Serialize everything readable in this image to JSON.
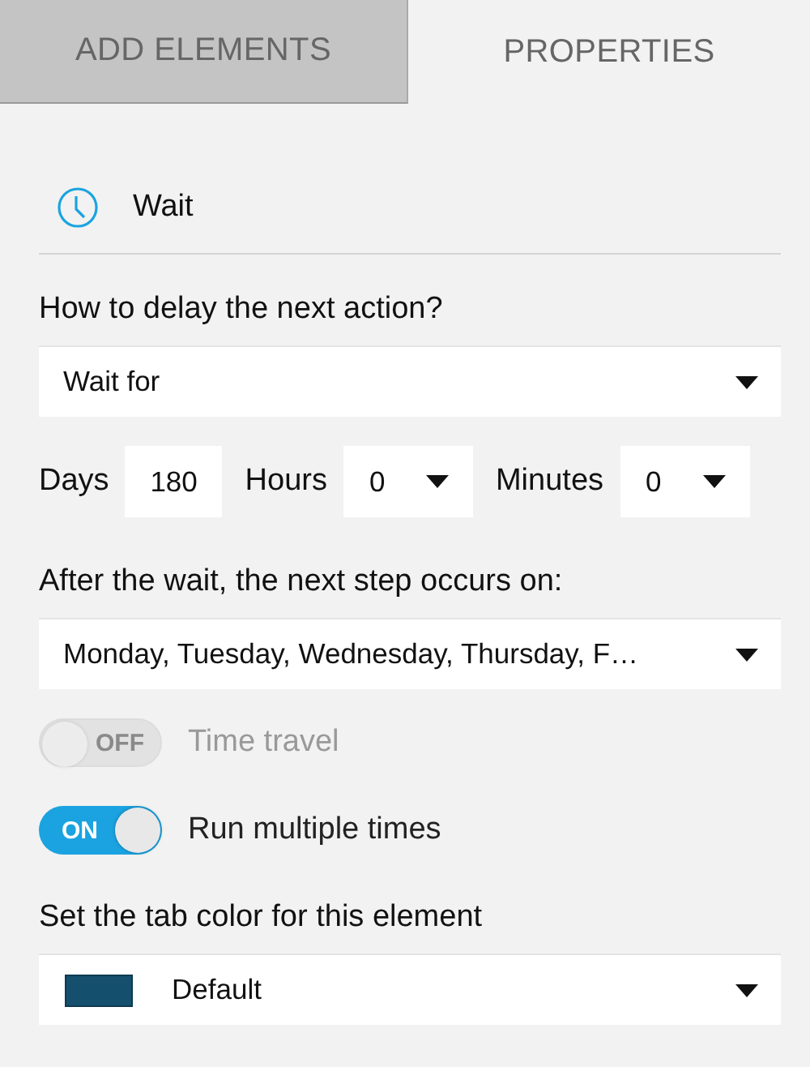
{
  "tabs": [
    {
      "label": "ADD ELEMENTS",
      "selected": false
    },
    {
      "label": "PROPERTIES",
      "selected": true
    }
  ],
  "element": {
    "title": "Wait"
  },
  "delay": {
    "label": "How to delay the next action?",
    "value": "Wait for"
  },
  "duration": [
    {
      "label": "Days",
      "kind": "input",
      "value": "180"
    },
    {
      "label": "Hours",
      "kind": "select",
      "value": "0"
    },
    {
      "label": "Minutes",
      "kind": "select",
      "value": "0"
    }
  ],
  "schedule": {
    "label": "After the wait, the next step occurs on:",
    "value": "Monday, Tuesday, Wednesday, Thursday, F…"
  },
  "toggles": [
    {
      "label": "Time travel",
      "state_text": "OFF",
      "on": false,
      "disabled": true
    },
    {
      "label": "Run multiple times",
      "state_text": "ON",
      "on": true,
      "disabled": false
    }
  ],
  "tab_color": {
    "label": "Set the tab color for this element",
    "value": "Default",
    "color": "#154f6e"
  }
}
